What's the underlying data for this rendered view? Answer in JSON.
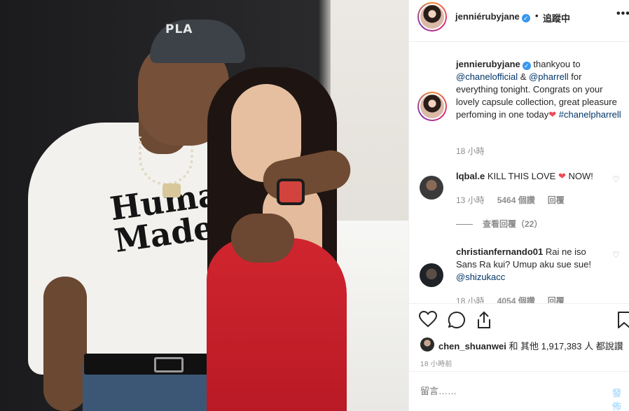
{
  "header": {
    "username": "jenniérubyjane",
    "follow_status": "追蹤中",
    "separator": "•",
    "more": "•••",
    "verified_mark": "✓"
  },
  "caption": {
    "username": "jennierubyjane",
    "text_1": "thankyou to",
    "mention_1": "@chanelofficial",
    "amp": "&",
    "mention_2": "@pharrell",
    "text_2": "for everything tonight. Congrats on your lovely capsule collection, great pleasure perfoming in one today",
    "heart": "❤",
    "hashtag": "#chanelpharrell",
    "time": "18 小時"
  },
  "comments": [
    {
      "username": "lqbal.e",
      "text": "KILL THIS LOVE",
      "heart": "❤",
      "text_after": "NOW!",
      "time": "13 小時",
      "likes": "5464 個讚",
      "reply": "回覆",
      "view_replies": "查看回覆（22）"
    },
    {
      "username": "christianfernando01",
      "text": "Rai ne iso Sans Ra kui? Umup aku sue sue!",
      "mention": "@shizukacc",
      "time": "18 小時",
      "likes": "4054 個讚",
      "reply": "回覆"
    }
  ],
  "photo": {
    "cap_text": "PLA",
    "shirt_text_1": "Human",
    "shirt_text_2": "Made"
  },
  "actions": {
    "like_icon": "heart-outline-icon",
    "comment_icon": "comment-bubble-icon",
    "share_icon": "share-icon",
    "save_icon": "bookmark-icon"
  },
  "likes": {
    "username": "chen_shuanwei",
    "text": "和 其他 1,917,383 人 都說讚"
  },
  "post_time": "18 小時前",
  "comment_box": {
    "placeholder": "留言……",
    "post_label": "發佈"
  },
  "colors": {
    "link": "#003569",
    "secondary_text": "#8e8e8e",
    "verified": "#3897f0",
    "heart": "#ed4956",
    "post_disabled": "#b2dffc"
  }
}
